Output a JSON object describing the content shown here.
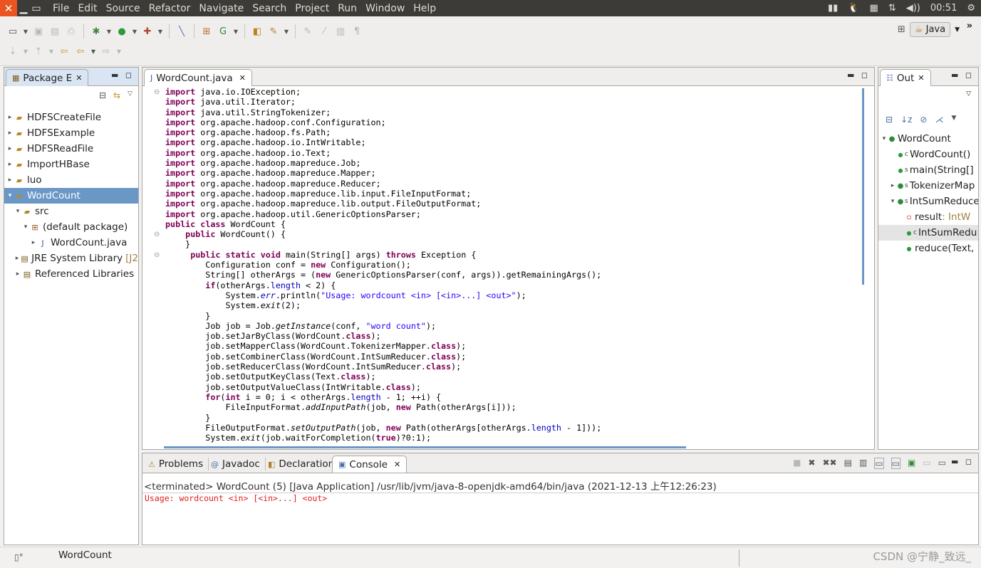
{
  "menu": [
    "File",
    "Edit",
    "Source",
    "Refactor",
    "Navigate",
    "Search",
    "Project",
    "Run",
    "Window",
    "Help"
  ],
  "tray": {
    "time": "00:51"
  },
  "perspective": {
    "label": "Java"
  },
  "package_explorer": {
    "tab_label": "Package E",
    "items": [
      {
        "label": "HDFSCreateFile",
        "indent": 0,
        "twisty": "▸",
        "icon": "project-icon"
      },
      {
        "label": "HDFSExample",
        "indent": 0,
        "twisty": "▸",
        "icon": "project-icon"
      },
      {
        "label": "HDFSReadFile",
        "indent": 0,
        "twisty": "▸",
        "icon": "project-icon"
      },
      {
        "label": "ImportHBase",
        "indent": 0,
        "twisty": "▸",
        "icon": "project-icon"
      },
      {
        "label": "luo",
        "indent": 0,
        "twisty": "▸",
        "icon": "project-icon"
      },
      {
        "label": "WordCount",
        "indent": 0,
        "twisty": "▾",
        "icon": "project-icon",
        "selected": true
      },
      {
        "label": "src",
        "indent": 1,
        "twisty": "▾",
        "icon": "source-folder-icon"
      },
      {
        "label": "(default package)",
        "indent": 2,
        "twisty": "▾",
        "icon": "package-icon"
      },
      {
        "label": "WordCount.java",
        "indent": 3,
        "twisty": "▸",
        "icon": "java-file-icon"
      },
      {
        "label": "JRE System Library",
        "suffix": "[J2",
        "indent": 1,
        "twisty": "▸",
        "icon": "library-icon"
      },
      {
        "label": "Referenced Libraries",
        "indent": 1,
        "twisty": "▸",
        "icon": "library-icon"
      }
    ]
  },
  "editor": {
    "tab_label": "WordCount.java",
    "lines": [
      [
        [
          "kw",
          "import"
        ],
        [
          "t",
          " java.io.IOException;"
        ]
      ],
      [
        [
          "kw",
          "import"
        ],
        [
          "t",
          " java.util.Iterator;"
        ]
      ],
      [
        [
          "kw",
          "import"
        ],
        [
          "t",
          " java.util.StringTokenizer;"
        ]
      ],
      [
        [
          "kw",
          "import"
        ],
        [
          "t",
          " org.apache.hadoop.conf.Configuration;"
        ]
      ],
      [
        [
          "kw",
          "import"
        ],
        [
          "t",
          " org.apache.hadoop.fs.Path;"
        ]
      ],
      [
        [
          "kw",
          "import"
        ],
        [
          "t",
          " org.apache.hadoop.io.IntWritable;"
        ]
      ],
      [
        [
          "kw",
          "import"
        ],
        [
          "t",
          " org.apache.hadoop.io.Text;"
        ]
      ],
      [
        [
          "kw",
          "import"
        ],
        [
          "t",
          " org.apache.hadoop.mapreduce.Job;"
        ]
      ],
      [
        [
          "kw",
          "import"
        ],
        [
          "t",
          " org.apache.hadoop.mapreduce.Mapper;"
        ]
      ],
      [
        [
          "kw",
          "import"
        ],
        [
          "t",
          " org.apache.hadoop.mapreduce.Reducer;"
        ]
      ],
      [
        [
          "kw",
          "import"
        ],
        [
          "t",
          " org.apache.hadoop.mapreduce.lib.input.FileInputFormat;"
        ]
      ],
      [
        [
          "kw",
          "import"
        ],
        [
          "t",
          " org.apache.hadoop.mapreduce.lib.output.FileOutputFormat;"
        ]
      ],
      [
        [
          "kw",
          "import"
        ],
        [
          "t",
          " org.apache.hadoop.util.GenericOptionsParser;"
        ]
      ],
      [
        [
          "kw",
          "public"
        ],
        [
          "t",
          " "
        ],
        [
          "kw",
          "class"
        ],
        [
          "t",
          " WordCount {"
        ]
      ],
      [
        [
          "t",
          "    "
        ],
        [
          "kw",
          "public"
        ],
        [
          "t",
          " WordCount() {"
        ]
      ],
      [
        [
          "t",
          "    }"
        ]
      ],
      [
        [
          "t",
          "     "
        ],
        [
          "kw",
          "public"
        ],
        [
          "t",
          " "
        ],
        [
          "kw",
          "static"
        ],
        [
          "t",
          " "
        ],
        [
          "kw",
          "void"
        ],
        [
          "t",
          " main(String[] args) "
        ],
        [
          "kw",
          "throws"
        ],
        [
          "t",
          " Exception {"
        ]
      ],
      [
        [
          "t",
          "        Configuration conf = "
        ],
        [
          "kw",
          "new"
        ],
        [
          "t",
          " Configuration();"
        ]
      ],
      [
        [
          "t",
          "        String[] otherArgs = ("
        ],
        [
          "kw",
          "new"
        ],
        [
          "t",
          " GenericOptionsParser(conf, args)).getRemainingArgs();"
        ]
      ],
      [
        [
          "t",
          "        "
        ],
        [
          "kw",
          "if"
        ],
        [
          "t",
          "(otherArgs."
        ],
        [
          "fld",
          "length"
        ],
        [
          "t",
          " < 2) {"
        ]
      ],
      [
        [
          "t",
          "            System."
        ],
        [
          "fi",
          "err"
        ],
        [
          "t",
          ".println("
        ],
        [
          "str",
          "\"Usage: wordcount <in> [<in>...] <out>\""
        ],
        [
          "t",
          ");"
        ]
      ],
      [
        [
          "t",
          "            System."
        ],
        [
          "it",
          "exit"
        ],
        [
          "t",
          "(2);"
        ]
      ],
      [
        [
          "t",
          "        }"
        ]
      ],
      [
        [
          "t",
          "        Job job = Job."
        ],
        [
          "it",
          "getInstance"
        ],
        [
          "t",
          "(conf, "
        ],
        [
          "str",
          "\"word count\""
        ],
        [
          "t",
          ");"
        ]
      ],
      [
        [
          "t",
          "        job.setJarByClass(WordCount."
        ],
        [
          "kw",
          "class"
        ],
        [
          "t",
          ");"
        ]
      ],
      [
        [
          "t",
          "        job.setMapperClass(WordCount.TokenizerMapper."
        ],
        [
          "kw",
          "class"
        ],
        [
          "t",
          ");"
        ]
      ],
      [
        [
          "t",
          "        job.setCombinerClass(WordCount.IntSumReducer."
        ],
        [
          "kw",
          "class"
        ],
        [
          "t",
          ");"
        ]
      ],
      [
        [
          "t",
          "        job.setReducerClass(WordCount.IntSumReducer."
        ],
        [
          "kw",
          "class"
        ],
        [
          "t",
          ");"
        ]
      ],
      [
        [
          "t",
          "        job.setOutputKeyClass(Text."
        ],
        [
          "kw",
          "class"
        ],
        [
          "t",
          ");"
        ]
      ],
      [
        [
          "t",
          "        job.setOutputValueClass(IntWritable."
        ],
        [
          "kw",
          "class"
        ],
        [
          "t",
          ");"
        ]
      ],
      [
        [
          "t",
          "        "
        ],
        [
          "kw",
          "for"
        ],
        [
          "t",
          "("
        ],
        [
          "kw",
          "int"
        ],
        [
          "t",
          " i = 0; i < otherArgs."
        ],
        [
          "fld",
          "length"
        ],
        [
          "t",
          " - 1; ++i) {"
        ]
      ],
      [
        [
          "t",
          "            FileInputFormat."
        ],
        [
          "it",
          "addInputPath"
        ],
        [
          "t",
          "(job, "
        ],
        [
          "kw",
          "new"
        ],
        [
          "t",
          " Path(otherArgs[i]));"
        ]
      ],
      [
        [
          "t",
          "        }"
        ]
      ],
      [
        [
          "t",
          "        FileOutputFormat."
        ],
        [
          "it",
          "setOutputPath"
        ],
        [
          "t",
          "(job, "
        ],
        [
          "kw",
          "new"
        ],
        [
          "t",
          " Path(otherArgs[otherArgs."
        ],
        [
          "fld",
          "length"
        ],
        [
          "t",
          " - 1]));"
        ]
      ],
      [
        [
          "t",
          "        System."
        ],
        [
          "it",
          "exit"
        ],
        [
          "t",
          "(job.waitForCompletion("
        ],
        [
          "kw",
          "true"
        ],
        [
          "t",
          ")?0:1);"
        ]
      ]
    ]
  },
  "outline": {
    "tab_label": "Out",
    "items": [
      {
        "label": "WordCount",
        "indent": 0,
        "twisty": "▾",
        "icon": "class-icon",
        "mod": ""
      },
      {
        "label": "WordCount()",
        "indent": 1,
        "twisty": "",
        "icon": "method-icon",
        "mod": "c"
      },
      {
        "label": "main(String[]",
        "indent": 1,
        "twisty": "",
        "icon": "method-icon",
        "mod": "s"
      },
      {
        "label": "TokenizerMap",
        "indent": 1,
        "twisty": "▸",
        "icon": "class-icon",
        "mod": "s"
      },
      {
        "label": "IntSumReduce",
        "indent": 1,
        "twisty": "▾",
        "icon": "class-icon",
        "mod": "s"
      },
      {
        "label": "result",
        "type": " : IntW",
        "indent": 2,
        "twisty": "",
        "icon": "field-icon",
        "mod": ""
      },
      {
        "label": "IntSumRedu",
        "indent": 2,
        "twisty": "",
        "icon": "method-icon",
        "mod": "c",
        "selected": true
      },
      {
        "label": "reduce(Text,",
        "indent": 2,
        "twisty": "",
        "icon": "method-icon",
        "mod": ""
      }
    ]
  },
  "bottom_tabs": [
    {
      "label": "Problems",
      "icon": "problems-icon"
    },
    {
      "label": "Javadoc",
      "icon": "javadoc-icon"
    },
    {
      "label": "Declaration",
      "icon": "declaration-icon"
    },
    {
      "label": "Console",
      "icon": "console-icon",
      "active": true
    }
  ],
  "console": {
    "terminated_line": "<terminated> WordCount (5) [Java Application] /usr/lib/jvm/java-8-openjdk-amd64/bin/java (2021-12-13 上午12:26:23)",
    "error_output": "Usage: wordcount <in> [<in>...] <out>"
  },
  "statusbar": {
    "text": "WordCount",
    "watermark": "CSDN @宁静_致远_"
  },
  "colors": {
    "selection": "#6b97c6",
    "keyword": "#7f0055",
    "string": "#2a00ff",
    "error": "#e02020",
    "ubuntu_orange": "#e95420"
  }
}
